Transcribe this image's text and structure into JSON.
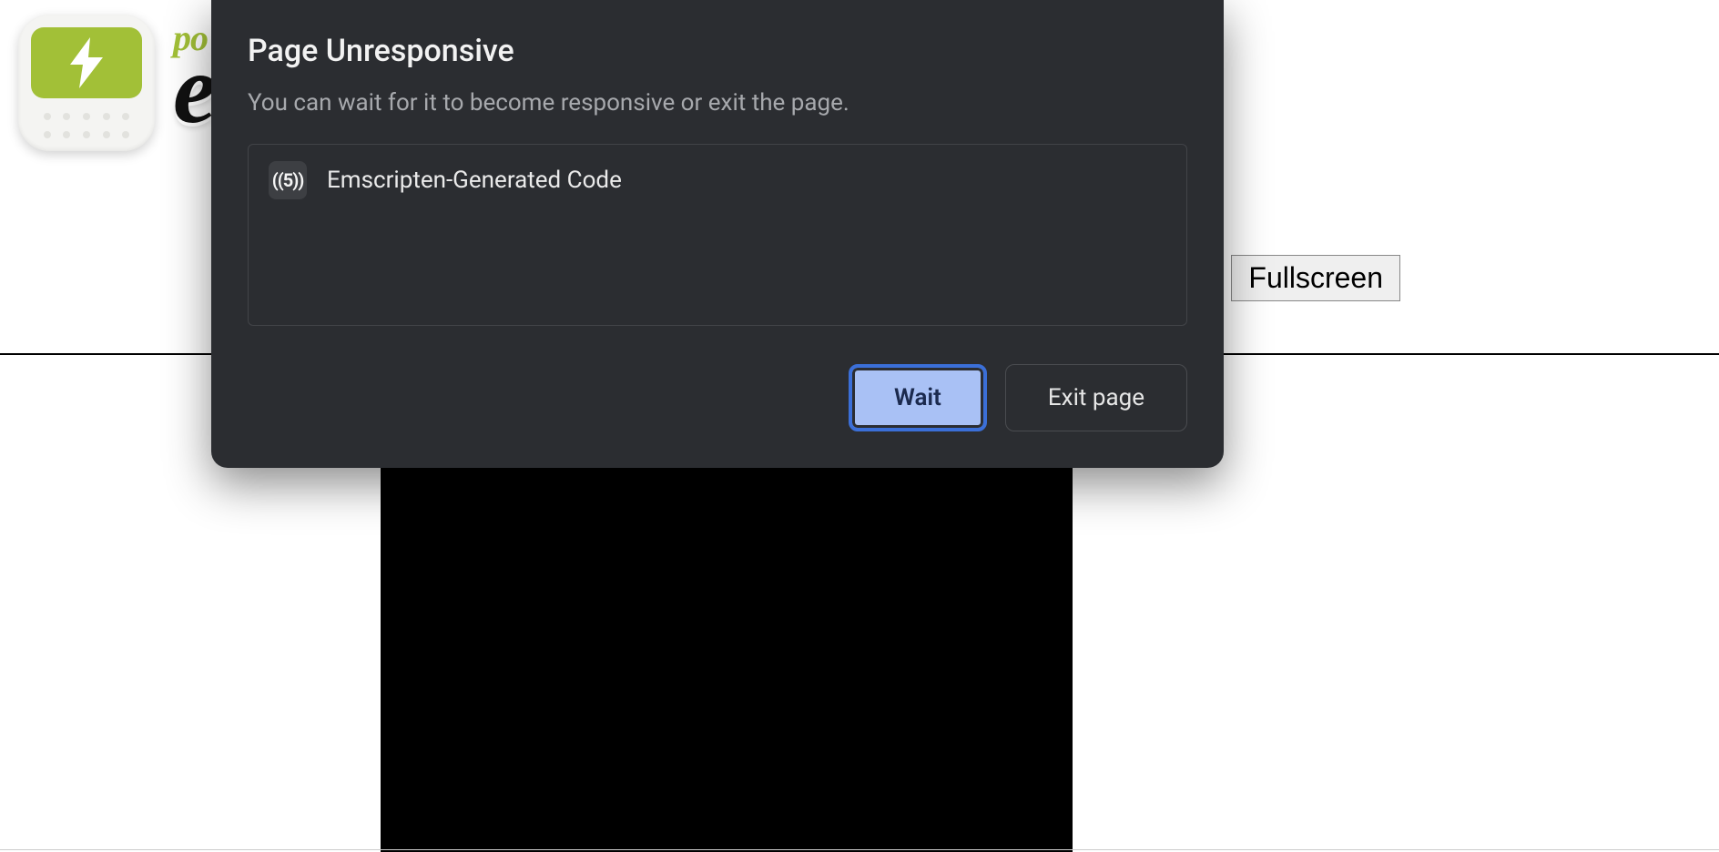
{
  "page": {
    "wordmark_top": "po",
    "wordmark_bottom": "en",
    "fullscreen_label": "Fullscreen"
  },
  "dialog": {
    "title": "Page Unresponsive",
    "subtitle": "You can wait for it to become responsive or exit the page.",
    "items": [
      {
        "favicon_text": "((5))",
        "title": "Emscripten-Generated Code"
      }
    ],
    "wait_label": "Wait",
    "exit_label": "Exit page"
  }
}
